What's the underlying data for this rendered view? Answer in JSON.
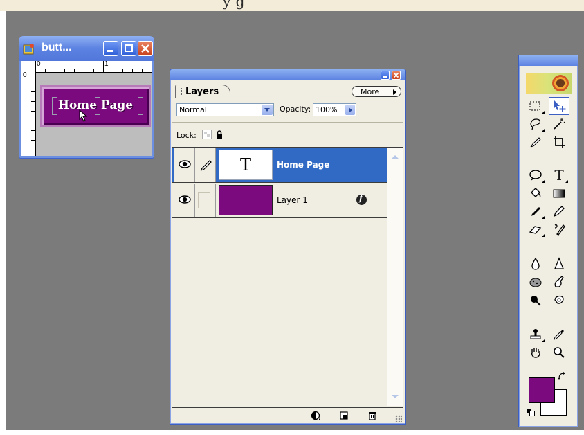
{
  "top_fragment": "y    g",
  "document_window": {
    "title": "butt...",
    "ruler_marks": [
      "0",
      "1"
    ],
    "ruler_left_mark": "0",
    "button_label": "Home Page",
    "button_color": "#7a0a7e"
  },
  "layers_panel": {
    "tab": "Layers",
    "more_button": "More",
    "blend_mode": "Normal",
    "opacity_label": "Opacity:",
    "opacity_value": "100%",
    "lock_label": "Lock:",
    "layers": [
      {
        "name": "Home Page",
        "thumbnail_text": "T",
        "selected": true
      },
      {
        "name": "Layer 1",
        "selected": false
      }
    ]
  },
  "toolbox": {
    "tools": [
      "marquee",
      "move",
      "lasso",
      "magic-wand",
      "brush-healing",
      "crop",
      "shape",
      "type",
      "paint-bucket",
      "gradient",
      "brush",
      "pencil",
      "eraser",
      "smudge-finger",
      "blur",
      "sharpen",
      "sponge",
      "liquify",
      "burn",
      "dodge",
      "clone-stamp",
      "eyedropper",
      "hand",
      "zoom"
    ],
    "type_glyph": "T",
    "foreground_color": "#7a0a7e",
    "background_color": "#ffffff"
  },
  "colors": {
    "desktop": "#7b7b7b",
    "selection": "#316ac5",
    "xp_title": "#5c82e2"
  }
}
